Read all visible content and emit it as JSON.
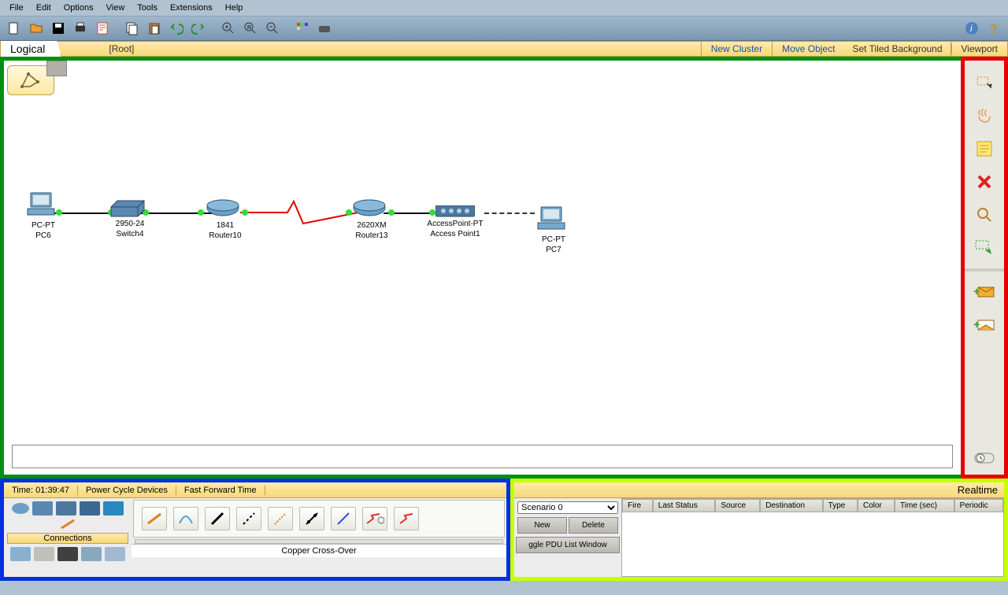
{
  "menus": [
    "File",
    "Edit",
    "Options",
    "View",
    "Tools",
    "Extensions",
    "Help"
  ],
  "topbar": {
    "logical": "Logical",
    "root": "[Root]",
    "new_cluster": "New Cluster",
    "move_object": "Move Object",
    "set_tiled_bg": "Set Tiled Background",
    "viewport": "Viewport"
  },
  "devices": {
    "pc6": {
      "line1": "PC-PT",
      "line2": "PC6"
    },
    "switch4": {
      "line1": "2950-24",
      "line2": "Switch4"
    },
    "router10": {
      "line1": "1841",
      "line2": "Router10"
    },
    "router13": {
      "line1": "2620XM",
      "line2": "Router13"
    },
    "ap1": {
      "line1": "AccessPoint-PT",
      "line2": "Access Point1"
    },
    "pc7": {
      "line1": "PC-PT",
      "line2": "PC7"
    }
  },
  "time_panel": {
    "time": "Time: 01:39:47",
    "power_cycle": "Power Cycle Devices",
    "fast_forward": "Fast Forward Time"
  },
  "connections_label": "Connections",
  "status_text": "Copper Cross-Over",
  "realtime": "Realtime",
  "scenario": {
    "selected": "Scenario 0",
    "new": "New",
    "delete": "Delete",
    "toggle": "ggle PDU List Window"
  },
  "pdu_headers": [
    "Fire",
    "Last Status",
    "Source",
    "Destination",
    "Type",
    "Color",
    "Time (sec)",
    "Periodic"
  ]
}
